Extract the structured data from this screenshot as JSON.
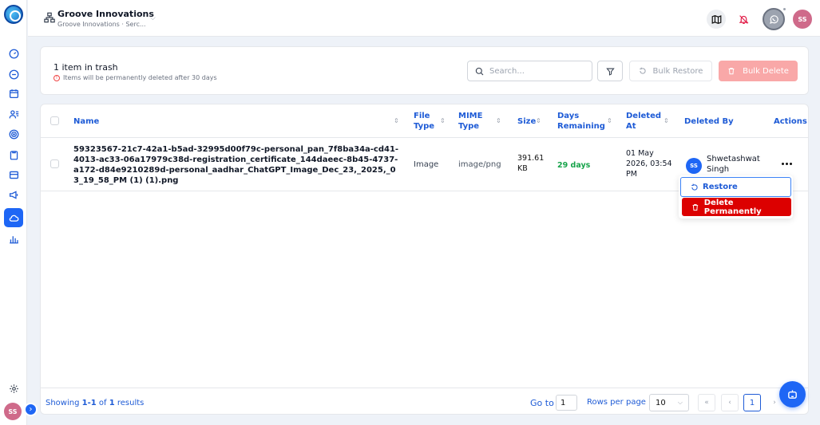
{
  "header": {
    "org_name": "Groove Innovations",
    "org_sub": "Groove Innovations · Serc...",
    "avatar_initials": "SS"
  },
  "sidebar": {
    "items": [
      {
        "icon": "dashboard-icon"
      },
      {
        "icon": "chat-icon"
      },
      {
        "icon": "calendar-icon"
      },
      {
        "icon": "users-icon"
      },
      {
        "icon": "target-icon"
      },
      {
        "icon": "clipboard-icon"
      },
      {
        "icon": "card-icon"
      },
      {
        "icon": "megaphone-icon"
      },
      {
        "icon": "cloud-icon",
        "active": true
      },
      {
        "icon": "analytics-icon"
      }
    ],
    "avatar_initials": "SS"
  },
  "trash": {
    "title": "1 item in trash",
    "warning": "Items will be permanently deleted after 30 days",
    "search_placeholder": "Search...",
    "bulk_restore": "Bulk Restore",
    "bulk_delete": "Bulk Delete"
  },
  "table": {
    "columns": {
      "name": "Name",
      "file_type": "File Type",
      "mime_type": "MIME Type",
      "size": "Size",
      "days_remaining": "Days Remaining",
      "deleted_at": "Deleted At",
      "deleted_by": "Deleted By",
      "actions": "Actions"
    },
    "rows": [
      {
        "name": "59323567-21c7-42a1-b5ad-32995d00f79c-personal_pan_7f8ba34a-cd41-4013-ac33-06a17979c38d-registration_certificate_144daeec-8b45-4737-a172-d84e9210289d-personal_aadhar_ChatGPT_Image_Dec_23,_2025,_03_19_58_PM (1) (1).png",
        "file_type": "Image",
        "mime_type": "image/png",
        "size": "391.61 KB",
        "days_remaining": "29 days",
        "deleted_at": "01 May 2026, 03:54 PM",
        "deleted_by": "Shwetashwat Singh",
        "deleted_by_initials": "SS"
      }
    ]
  },
  "action_menu": {
    "restore": "Restore",
    "delete_permanently": "Delete Permanently"
  },
  "footer": {
    "showing_prefix": "Showing ",
    "showing_range": "1-1",
    "showing_of": " of ",
    "showing_total": "1",
    "showing_suffix": " results",
    "goto_label": "Go to",
    "goto_value": "1",
    "rows_per_page_label": "Rows per page",
    "rows_per_page_value": "10",
    "current_page": "1"
  },
  "colors": {
    "accent": "#1e66f5",
    "danger": "#dc0000",
    "success": "#16a34a"
  }
}
